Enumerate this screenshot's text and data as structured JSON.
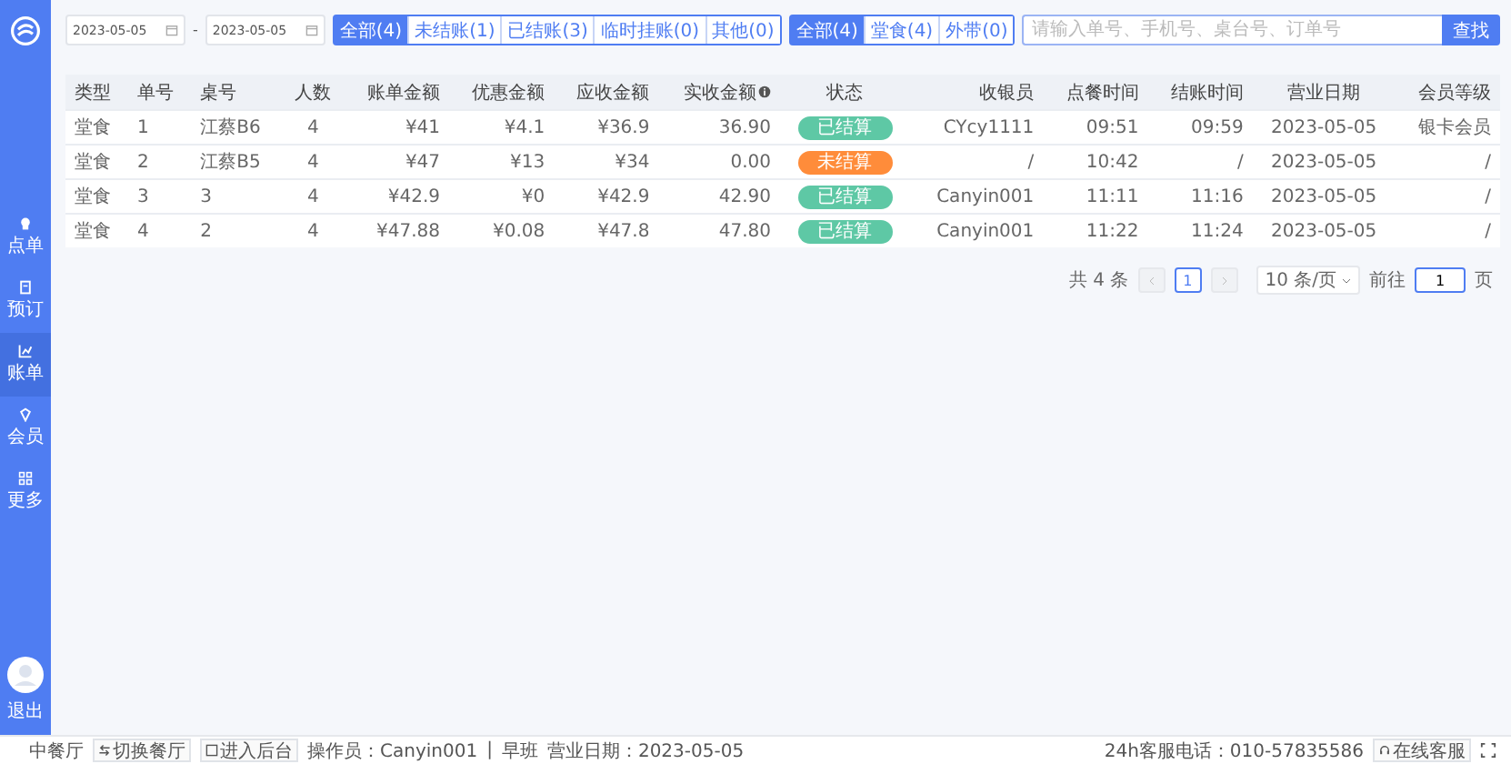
{
  "sidebar": {
    "items": [
      {
        "label": "点单",
        "selected": false
      },
      {
        "label": "预订",
        "selected": false
      },
      {
        "label": "账单",
        "selected": true
      },
      {
        "label": "会员",
        "selected": false
      },
      {
        "label": "更多",
        "selected": false
      }
    ],
    "logout": "退出"
  },
  "date_range": {
    "start": "2023-05-05",
    "separator": "-",
    "end": "2023-05-05"
  },
  "status_filters": [
    {
      "label": "全部(4)",
      "selected": true
    },
    {
      "label": "未结账(1)",
      "selected": false
    },
    {
      "label": "已结账(3)",
      "selected": false
    },
    {
      "label": "临时挂账(0)",
      "selected": false
    },
    {
      "label": "其他(0)",
      "selected": false
    }
  ],
  "type_filters": [
    {
      "label": "全部(4)",
      "selected": true
    },
    {
      "label": "堂食(4)",
      "selected": false
    },
    {
      "label": "外带(0)",
      "selected": false
    }
  ],
  "search": {
    "placeholder": "请输入单号、手机号、桌台号、订单号",
    "button": "查找"
  },
  "table": {
    "columns": [
      "类型",
      "单号",
      "桌号",
      "人数",
      "账单金额",
      "优惠金额",
      "应收金额",
      "实收金额",
      "状态",
      "收银员",
      "点餐时间",
      "结账时间",
      "营业日期",
      "会员等级"
    ],
    "rows": [
      {
        "cells": [
          "堂食",
          "1",
          "江蔡B6",
          "4",
          "¥41",
          "¥4.1",
          "¥36.9",
          "36.90"
        ],
        "status": {
          "text": "已结算",
          "kind": "settled"
        },
        "rest": [
          "CYcy1111",
          "09:51",
          "09:59",
          "2023-05-05",
          "银卡会员"
        ]
      },
      {
        "cells": [
          "堂食",
          "2",
          "江蔡B5",
          "4",
          "¥47",
          "¥13",
          "¥34",
          "0.00"
        ],
        "status": {
          "text": "未结算",
          "kind": "unsettled"
        },
        "rest": [
          "/",
          "10:42",
          "/",
          "2023-05-05",
          "/"
        ]
      },
      {
        "cells": [
          "堂食",
          "3",
          "3",
          "4",
          "¥42.9",
          "¥0",
          "¥42.9",
          "42.90"
        ],
        "status": {
          "text": "已结算",
          "kind": "settled"
        },
        "rest": [
          "Canyin001",
          "11:11",
          "11:16",
          "2023-05-05",
          "/"
        ]
      },
      {
        "cells": [
          "堂食",
          "4",
          "2",
          "4",
          "¥47.88",
          "¥0.08",
          "¥47.8",
          "47.80"
        ],
        "status": {
          "text": "已结算",
          "kind": "settled"
        },
        "rest": [
          "Canyin001",
          "11:22",
          "11:24",
          "2023-05-05",
          "/"
        ]
      }
    ]
  },
  "pagination": {
    "total": "共 4 条",
    "pages": [
      {
        "label": "1",
        "selected": true
      }
    ],
    "page_size": "10 条/页",
    "goto_label": "前往",
    "goto_value": "1",
    "goto_unit": "页"
  },
  "status_bar": {
    "hall": "中餐厅",
    "switch": "切换餐厅",
    "backend": "进入后台",
    "operator": "操作员：Canyin001",
    "separator": "|",
    "shift": "早班",
    "business_date": "营业日期：2023-05-05",
    "hotline": "24h客服电话：010-57835586",
    "service": "在线客服"
  }
}
